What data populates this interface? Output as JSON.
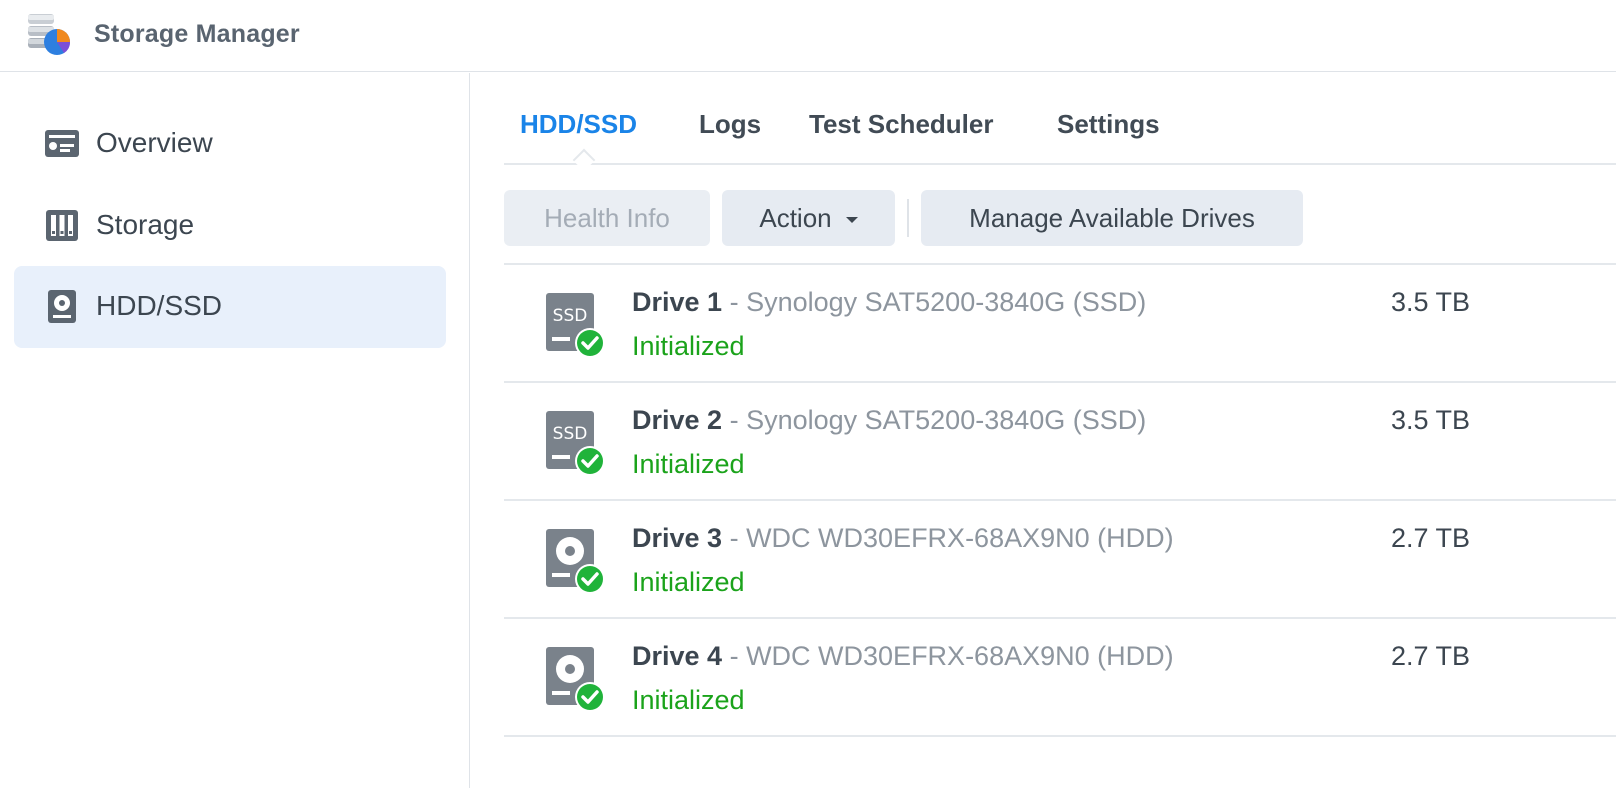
{
  "app": {
    "title": "Storage Manager"
  },
  "sidebar": {
    "items": [
      {
        "label": "Overview",
        "icon": "overview-icon",
        "active": false
      },
      {
        "label": "Storage",
        "icon": "storage-icon",
        "active": false
      },
      {
        "label": "HDD/SSD",
        "icon": "hdd-icon",
        "active": true
      }
    ]
  },
  "tabs": [
    {
      "label": "HDD/SSD",
      "active": true
    },
    {
      "label": "Logs",
      "active": false
    },
    {
      "label": "Test Scheduler",
      "active": false
    },
    {
      "label": "Settings",
      "active": false
    }
  ],
  "toolbar": {
    "health_info_label": "Health Info",
    "action_label": "Action",
    "manage_label": "Manage Available Drives"
  },
  "drives": [
    {
      "name": "Drive 1",
      "separator": " - ",
      "model": "Synology SAT5200-3840G (SSD)",
      "status": "Initialized",
      "size": "3.5 TB",
      "type": "SSD"
    },
    {
      "name": "Drive 2",
      "separator": " - ",
      "model": "Synology SAT5200-3840G (SSD)",
      "status": "Initialized",
      "size": "3.5 TB",
      "type": "SSD"
    },
    {
      "name": "Drive 3",
      "separator": " - ",
      "model": "WDC WD30EFRX-68AX9N0 (HDD)",
      "status": "Initialized",
      "size": "2.7 TB",
      "type": "HDD"
    },
    {
      "name": "Drive 4",
      "separator": " - ",
      "model": "WDC WD30EFRX-68AX9N0 (HDD)",
      "status": "Initialized",
      "size": "2.7 TB",
      "type": "HDD"
    }
  ],
  "colors": {
    "accent": "#1a84e8",
    "status_ok": "#1ba31b",
    "sidebar_active_bg": "#e8f0fb"
  }
}
